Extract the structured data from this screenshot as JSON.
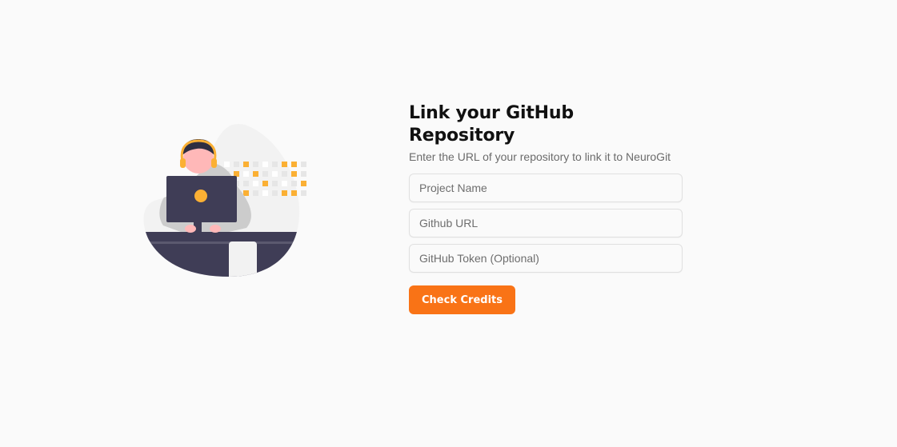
{
  "page": {
    "title": "Link your GitHub Repository",
    "subtitle": "Enter the URL of your repository to link it to NeuroGit"
  },
  "form": {
    "project_name": {
      "placeholder": "Project Name",
      "value": ""
    },
    "github_url": {
      "placeholder": "Github URL",
      "value": ""
    },
    "github_token": {
      "placeholder": "GitHub Token (Optional)",
      "value": ""
    },
    "submit_label": "Check Credits"
  },
  "illustration": {
    "icon": "developer-at-laptop-illustration",
    "colors": {
      "accent": "#fbb034",
      "dark": "#3f3d56",
      "skin": "#ffb8b8",
      "hair": "#2f2e41",
      "blob": "#f2f2f2",
      "shirt": "#cccccc"
    }
  },
  "colors": {
    "primary_button": "#f97316",
    "background": "#fafafa",
    "title": "#111111",
    "subtitle": "#6b6b6b"
  }
}
